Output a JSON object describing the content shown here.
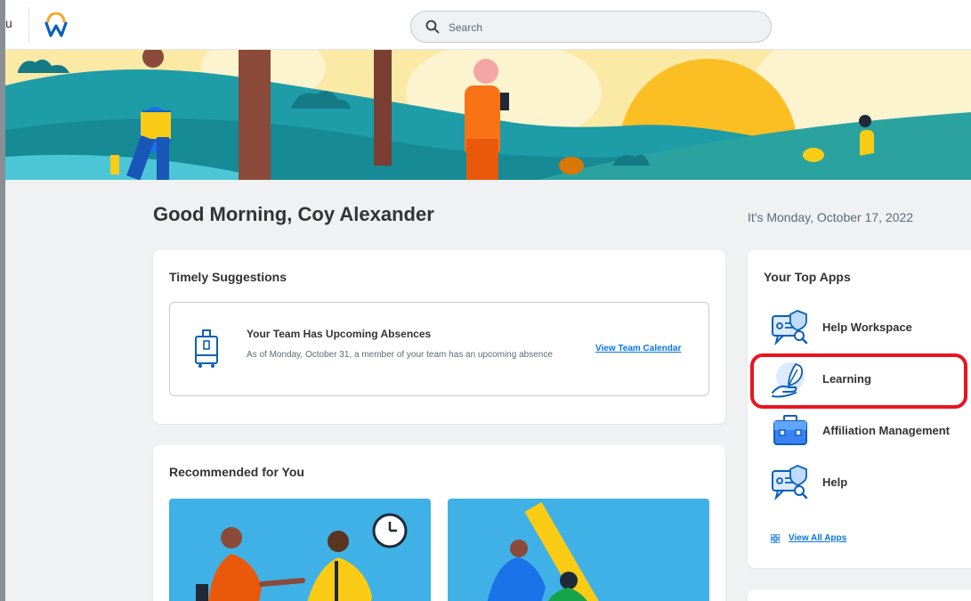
{
  "topbar": {
    "menu_fragment": "u",
    "logo_icon": "workday-logo-icon",
    "search": {
      "placeholder": "Search",
      "value": ""
    }
  },
  "greeting": "Good Morning, Coy Alexander",
  "date": "It's Monday, October 17, 2022",
  "timely_suggestions": {
    "title": "Timely Suggestions",
    "item": {
      "icon": "luggage-icon",
      "title": "Your Team Has Upcoming Absences",
      "description": "As of Monday, October 31, a member of your team has an upcoming absence",
      "link": "View Team Calendar"
    }
  },
  "recommended": {
    "title": "Recommended for You"
  },
  "top_apps": {
    "title": "Your Top Apps",
    "items": [
      {
        "label": "Help Workspace",
        "icon": "help-workspace-icon"
      },
      {
        "label": "Learning",
        "icon": "learning-icon"
      },
      {
        "label": "Affiliation Management",
        "icon": "briefcase-icon"
      },
      {
        "label": "Help",
        "icon": "help-icon"
      }
    ],
    "view_all": "View All Apps"
  },
  "colors": {
    "accent_link": "#0875e1",
    "highlight": "#e8141e",
    "banner_sky": "#fbe9a6",
    "banner_hill": "#1e9ca8",
    "rec_image_bg": "#3fb1e6"
  }
}
